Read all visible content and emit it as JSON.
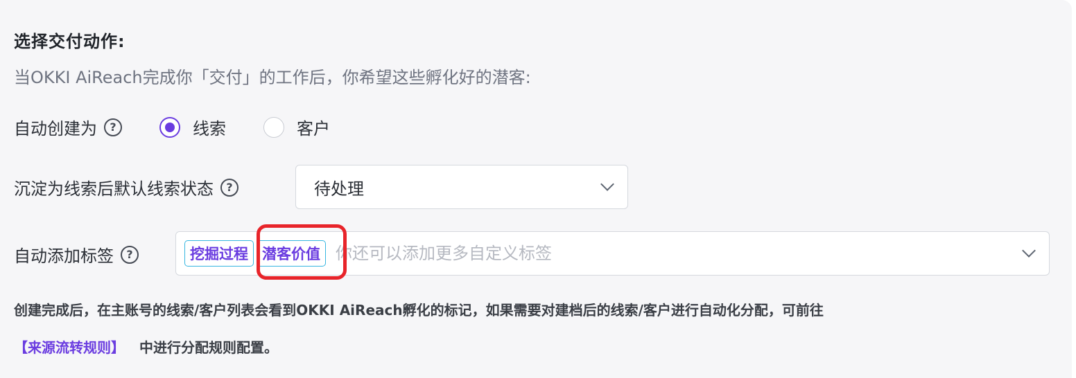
{
  "section": {
    "title": "选择交付动作:",
    "subtitle": "当OKKI AiReach完成你「交付」的工作后，你希望这些孵化好的潜客:"
  },
  "auto_create": {
    "label": "自动创建为",
    "help_icon": "question-circle-icon",
    "options": [
      {
        "label": "线索",
        "checked": true
      },
      {
        "label": "客户",
        "checked": false
      }
    ]
  },
  "lead_status": {
    "label": "沉淀为线索后默认线索状态",
    "help_icon": "question-circle-icon",
    "value": "待处理",
    "dropdown_icon": "chevron-down-icon"
  },
  "tags": {
    "label": "自动添加标签",
    "help_icon": "question-circle-icon",
    "items": [
      "挖掘过程",
      "潜客价值"
    ],
    "placeholder": "你还可以添加更多自定义标签",
    "dropdown_icon": "chevron-down-icon"
  },
  "note": {
    "text": "创建完成后，在主账号的线索/客户列表会看到OKKI AiReach孵化的标记，如果需要对建档后的线索/客户进行自动化分配，可前往",
    "link_text": "【来源流转规则】",
    "suffix": "中进行分配规则配置。"
  },
  "colors": {
    "accent": "#6a3ce0",
    "tag_border": "#36b6e0",
    "highlight": "#e8242a",
    "panel_bg": "#f6f6f8"
  }
}
